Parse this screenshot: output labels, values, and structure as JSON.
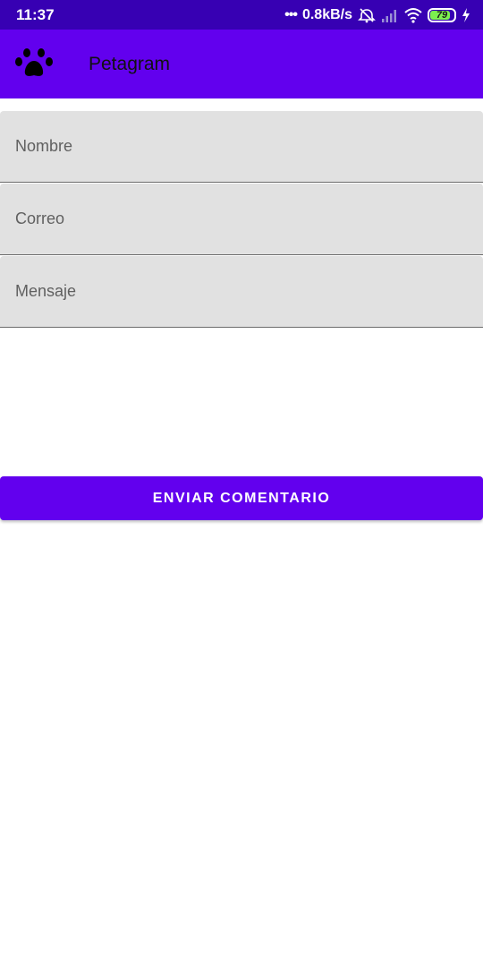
{
  "status_bar": {
    "time": "11:37",
    "dots": "•••",
    "net_speed": "0.8kB/s",
    "battery_level": "79",
    "icons": [
      "alarm-off-icon",
      "signal-icon",
      "wifi-icon",
      "battery-icon",
      "charging-icon"
    ]
  },
  "app_bar": {
    "title": "Petagram",
    "logo_icon": "paw-icon"
  },
  "form": {
    "name_placeholder": "Nombre",
    "email_placeholder": "Correo",
    "message_placeholder": "Mensaje",
    "name_value": "",
    "email_value": "",
    "message_value": "",
    "submit_label": "ENVIAR COMENTARIO"
  },
  "colors": {
    "status_bar": "#3700b3",
    "primary": "#6200ee",
    "field_background": "#e1e1e1",
    "battery_fill": "#7cf04f"
  }
}
